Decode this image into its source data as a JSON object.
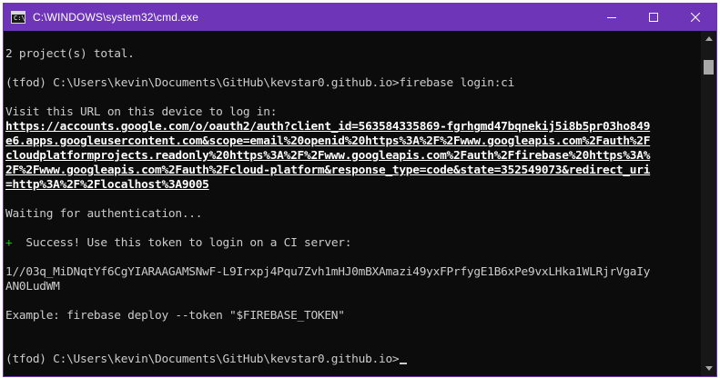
{
  "window": {
    "title": "C:\\WINDOWS\\system32\\cmd.exe",
    "icon": "cmd-icon",
    "icon_glyph": "C:\\",
    "controls": {
      "minimize": "minimize-icon",
      "maximize": "maximize-icon",
      "close": "close-icon"
    }
  },
  "colors": {
    "titlebar": "#6e35b8",
    "terminal_bg": "#0c0c0c",
    "text": "#cccccc",
    "link": "#ffffff",
    "success_plus": "#16c60c"
  },
  "terminal": {
    "lines": {
      "l0": "2 project(s) total.",
      "l1": "(tfod) C:\\Users\\kevin\\Documents\\GitHub\\kevstar0.github.io>firebase login:ci",
      "l2": "Visit this URL on this device to log in:",
      "url1": "https://accounts.google.com/o/oauth2/auth?client_id=563584335869-fgrhgmd47bqnekij5i8b5pr03ho849",
      "url2": "e6.apps.googleusercontent.com&scope=email%20openid%20https%3A%2F%2Fwww.googleapis.com%2Fauth%2F",
      "url3": "cloudplatformprojects.readonly%20https%3A%2F%2Fwww.googleapis.com%2Fauth%2Ffirebase%20https%3A%",
      "url4": "2F%2Fwww.googleapis.com%2Fauth%2Fcloud-platform&response_type=code&state=352549073&redirect_uri",
      "url5": "=http%3A%2F%2Flocalhost%3A9005",
      "waiting": "Waiting for authentication...",
      "success_plus": "+",
      "success": "  Success! Use this token to login on a CI server:",
      "token1": "1//03q_MiDNqtYf6CgYIARAAGAMSNwF-L9Irxpj4Pqu7Zvh1mHJ0mBXAmazi49yxFPrfygE1B6xPe9vxLHka1WLRjrVgaIy",
      "token2": "AN0LudWM",
      "example": "Example: firebase deploy --token \"$FIREBASE_TOKEN\"",
      "prompt": "(tfod) C:\\Users\\kevin\\Documents\\GitHub\\kevstar0.github.io>"
    }
  },
  "scrollbar": {
    "up": "scroll-up-arrow-icon",
    "down": "scroll-down-arrow-icon"
  }
}
